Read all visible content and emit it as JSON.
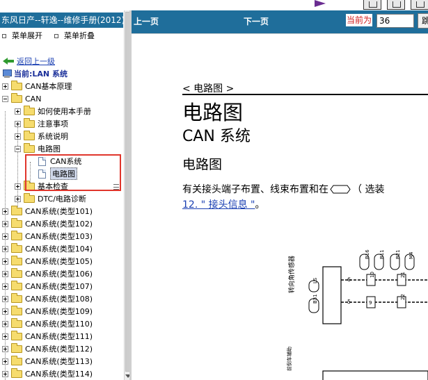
{
  "window": {
    "title": "东风日产--轩逸--维修手册(2012)"
  },
  "menu": {
    "expand_label": "菜单展开",
    "collapse_label": "菜单折叠"
  },
  "tree": {
    "back_label": "返回上一级",
    "current_label": "当前:LAN 系统",
    "items": [
      {
        "label": "CAN基本原理"
      },
      {
        "label": "CAN"
      },
      {
        "label": "如何使用本手册"
      },
      {
        "label": "注意事项"
      },
      {
        "label": "系统说明"
      },
      {
        "label": "电路图"
      },
      {
        "label": "CAN系统"
      },
      {
        "label": "电路图"
      },
      {
        "label": "基本检查"
      },
      {
        "label": "DTC/电路诊断"
      },
      {
        "label": "CAN系统(类型101)"
      },
      {
        "label": "CAN系统(类型102)"
      },
      {
        "label": "CAN系统(类型103)"
      },
      {
        "label": "CAN系统(类型104)"
      },
      {
        "label": "CAN系统(类型105)"
      },
      {
        "label": "CAN系统(类型106)"
      },
      {
        "label": "CAN系统(类型107)"
      },
      {
        "label": "CAN系统(类型108)"
      },
      {
        "label": "CAN系统(类型109)"
      },
      {
        "label": "CAN系统(类型110)"
      },
      {
        "label": "CAN系统(类型111)"
      },
      {
        "label": "CAN系统(类型112)"
      },
      {
        "label": "CAN系统(类型113)"
      },
      {
        "label": "CAN系统(类型114)"
      }
    ]
  },
  "toolbar": {
    "prev_label": "上一页",
    "next_label": "下一页",
    "page_label": "当前为",
    "page_value": "36",
    "go_label": "跳"
  },
  "document": {
    "breadcrumb": "< 电路图 >",
    "title": "电路图",
    "subtitle": "CAN 系统",
    "section": "电路图",
    "para_line1_a": "有关接头端子布置、线束布置和在",
    "para_line1_b": "（ 选装",
    "para_link": "12. \" 接头信息 \"",
    "para_end": "。"
  },
  "diagram": {
    "module_label": "转向角传感器",
    "connector_ls": "LS",
    "connector_b31": "B31",
    "pin_6": "6",
    "pin_5": "5",
    "conn_b16": "B16",
    "conn_b11": "B11",
    "conn_b21": "B21",
    "conn_m4": "M4",
    "pin_10": "10",
    "pin_9": "9",
    "pin_21": "21",
    "pin_22": "22",
    "bottom_label_1": "前倒车辅助",
    "bottom_label_2": "CS"
  },
  "colors": {
    "titlebar_blue": "#1f6e9b",
    "link_blue": "#1a3fb2",
    "highlight_red": "#e0352b",
    "page_label_red": "#d11b1b"
  }
}
